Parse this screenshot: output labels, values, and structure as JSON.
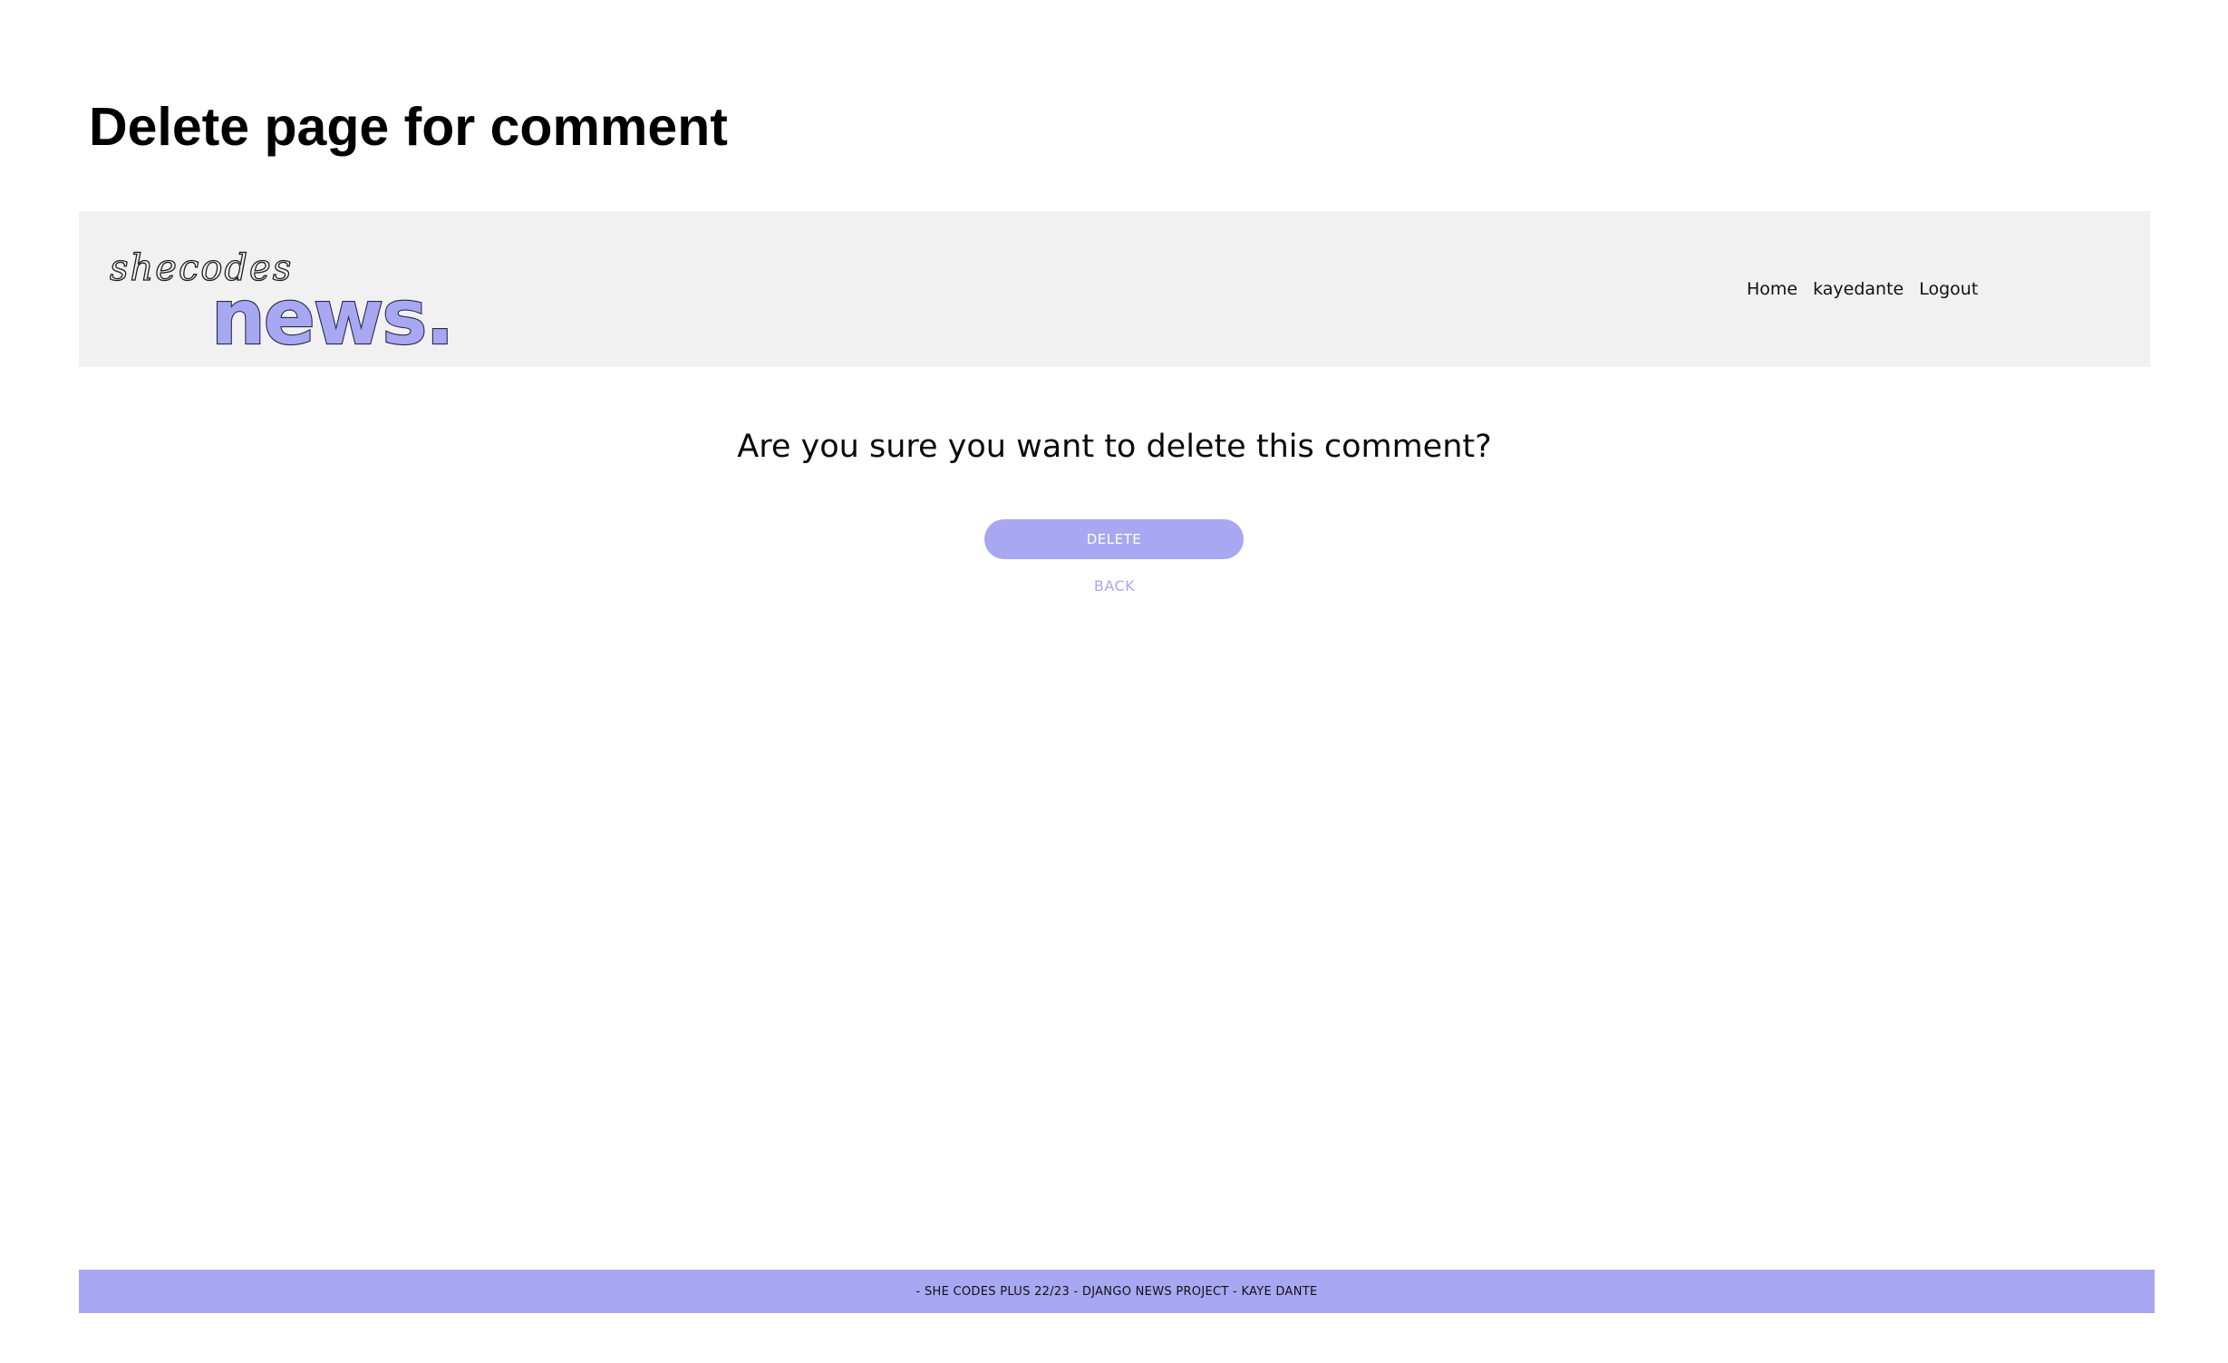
{
  "document": {
    "title": "Delete page for comment"
  },
  "header": {
    "logo": {
      "script_text": "shecodes",
      "brand_text": "news.",
      "brand_color": "#a7a7f2"
    },
    "nav": {
      "home": "Home",
      "username": "kayedante",
      "logout": "Logout"
    },
    "background": "#f1f1f1"
  },
  "main": {
    "question": "Are you sure you want to delete this comment?",
    "delete_label": "DELETE",
    "back_label": "BACK"
  },
  "footer": {
    "text": "- SHE CODES PLUS 22/23 - DJANGO NEWS PROJECT - KAYE DANTE",
    "background": "#a7a7f2"
  }
}
